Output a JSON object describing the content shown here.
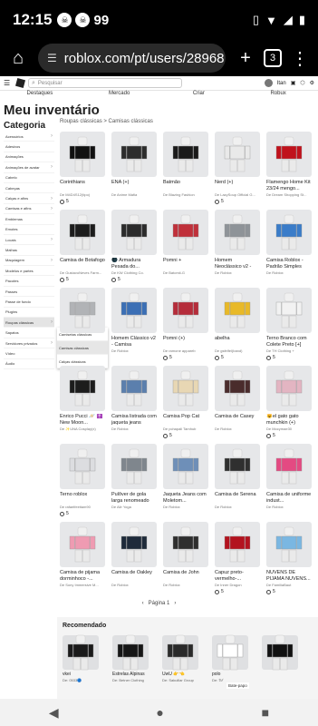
{
  "status": {
    "time": "12:15",
    "signal_num": "99"
  },
  "browser": {
    "url": "roblox.com/pt/users/28968",
    "tabs": "3"
  },
  "nav": {
    "search_placeholder": "Pesquisar",
    "user": "Itan",
    "robux": "0",
    "categories": [
      "Destaques",
      "Mercado",
      "Criar",
      "Robux"
    ]
  },
  "page": {
    "title": "Meu inventário",
    "category_heading": "Categoria",
    "breadcrumb": "Roupas clássicas > Camisas clássicas"
  },
  "sidebar": [
    {
      "label": "Acessórios",
      "arrow": true
    },
    {
      "label": "Adesivos",
      "arrow": false
    },
    {
      "label": "Animações",
      "arrow": false
    },
    {
      "label": "Animações de avatar",
      "arrow": true
    },
    {
      "label": "Cabelo",
      "arrow": false
    },
    {
      "label": "Cabeças",
      "arrow": false
    },
    {
      "label": "Calças e afins",
      "arrow": true
    },
    {
      "label": "Camisas e afins",
      "arrow": true
    },
    {
      "label": "Emblemas",
      "arrow": false
    },
    {
      "label": "Emotes",
      "arrow": false
    },
    {
      "label": "Locais",
      "arrow": true
    },
    {
      "label": "Malhas",
      "arrow": false
    },
    {
      "label": "Maquiagem",
      "arrow": true
    },
    {
      "label": "Modelos e partes",
      "arrow": false
    },
    {
      "label": "Pacotes",
      "arrow": false
    },
    {
      "label": "Passes",
      "arrow": false
    },
    {
      "label": "Passe de fundo",
      "arrow": false
    },
    {
      "label": "Plugins",
      "arrow": false
    },
    {
      "label": "Roupas clássicas",
      "arrow": true,
      "active": true
    },
    {
      "label": "Sapatos",
      "arrow": false
    },
    {
      "label": "Servidores privados",
      "arrow": true
    },
    {
      "label": "Vídeo",
      "arrow": false
    },
    {
      "label": "Áudio",
      "arrow": false
    }
  ],
  "submenu": [
    {
      "label": "Camisetas clássicas"
    },
    {
      "label": "Camisas clássicas",
      "active": true
    },
    {
      "label": "Calças clássicas"
    }
  ],
  "items": [
    {
      "name": "Corinthians",
      "by": "De M4D4S12(tipo)",
      "price": "5",
      "color": "#111111"
    },
    {
      "name": "ENA (+)",
      "by": "De Anime Mafia",
      "price": "",
      "color": "#2c2c2c"
    },
    {
      "name": "Batmão",
      "by": "De Blazing Fashion",
      "price": "",
      "color": "#1a1a1a"
    },
    {
      "name": "Nerd (+)",
      "by": "De LazySoup Official G...",
      "price": "5",
      "color": "#e9e9e9"
    },
    {
      "name": "Flamengo Home Kit 23/24 mengo...",
      "by": "De Dream Shopping St...",
      "price": "",
      "color": "#c0121c"
    },
    {
      "name": "Camisa de Botafogo",
      "by": "De GustavoNeves Farm...",
      "price": "5",
      "color": "#1c1c1c"
    },
    {
      "name": "🌑 Armadura Pesada do...",
      "by": "De KW Clothing Co.",
      "price": "5",
      "color": "#2b2b2b"
    },
    {
      "name": "Pomni +",
      "by": "De Batomii-G",
      "price": "",
      "color": "#c0303a"
    },
    {
      "name": "Homem Neoclássico v2 - Camisa",
      "by": "De Roblox",
      "price": "",
      "color": "#8e9398"
    },
    {
      "name": "Camisa Roblox - Padrão Simples",
      "by": "De Roblox",
      "price": "",
      "color": "#3a7cc9"
    },
    {
      "name": "",
      "by": "",
      "price": "",
      "color": "#b1b3b6"
    },
    {
      "name": "Homem Clássico v2 - Camisa",
      "by": "De Roblox",
      "price": "",
      "color": "#3b6fb5"
    },
    {
      "name": "Pomni (+)",
      "by": "De ramone appareb",
      "price": "5",
      "color": "#b52c3a"
    },
    {
      "name": "abelha",
      "by": "De gsfelfel(band)",
      "price": "5",
      "color": "#e8b928"
    },
    {
      "name": "Terno Branco com Colete Preto [+]",
      "by": "De TH Clothing +",
      "price": "5",
      "color": "#f2f2f2"
    },
    {
      "name": "Enrico Pucci 🪐 ✝️ New Moon...",
      "by": "De ✨UNA Cosplay(x)",
      "price": "",
      "color": "#1c1c1c"
    },
    {
      "name": "Camisa listrada com jaqueta jeans",
      "by": "De Roblox",
      "price": "",
      "color": "#5b7fad"
    },
    {
      "name": "Camisa Pop Cat",
      "by": "De pchapali Tamhub",
      "price": "5",
      "color": "#e8d7b4"
    },
    {
      "name": "Camisa de Casey",
      "by": "De Roblox",
      "price": "",
      "color": "#4a2c2c"
    },
    {
      "name": "😺el gato gato munchkin (+)",
      "by": "De Mocymae30",
      "price": "5",
      "color": "#e3b5c2"
    },
    {
      "name": "Terno roblox",
      "by": "De rafaelfeeitam90",
      "price": "5",
      "color": "#dcdde0"
    },
    {
      "name": "Pulôver de gola larga renomeado",
      "by": "De Alir Yoga",
      "price": "",
      "color": "#7f868d"
    },
    {
      "name": "Jaqueta Jeans com Moletom...",
      "by": "De Roblox",
      "price": "",
      "color": "#6e8fb8"
    },
    {
      "name": "Camisa de Serena",
      "by": "De Roblox",
      "price": "",
      "color": "#2f2f2f"
    },
    {
      "name": "Camisa de uniforme indust...",
      "by": "De Roblox",
      "price": "",
      "color": "#e44a82"
    },
    {
      "name": "Camisa de pijama dorminhoco -...",
      "by": "De Sony Immersive M...",
      "price": "",
      "color": "#ef9bb2"
    },
    {
      "name": "Camisa de Oakley",
      "by": "De Roblox",
      "price": "",
      "color": "#1e2a3a"
    },
    {
      "name": "Camisa de John",
      "by": "De Roblox",
      "price": "",
      "color": "#2e2e2e"
    },
    {
      "name": "Capuz preto-vermelho-...",
      "by": "De Inner Dragon",
      "price": "5",
      "color": "#b3131f"
    },
    {
      "name": "NUVENS DE PIJAMA NUVENS...",
      "by": "De FamiliaBaut",
      "price": "5",
      "color": "#7ab7e2"
    }
  ],
  "pagination": {
    "prev": "‹",
    "label": "Página 1",
    "next": "›"
  },
  "recommended": {
    "title": "Recomendado",
    "items": [
      {
        "name": "vkei",
        "by": "De: 0533🔵",
        "color": "#1a1a1a"
      },
      {
        "name": "Estrelas Alpinas",
        "by": "De: Betner Clothing",
        "color": "#161616"
      },
      {
        "name": "UwU 👉👈",
        "by": "De: Sakuillar Group",
        "color": "#2a2a2a"
      },
      {
        "name": "polo",
        "by": "De: ℬ𝓁",
        "color": "#ffffff"
      },
      {
        "name": "",
        "by": "",
        "color": "#111111"
      }
    ]
  },
  "chat_label": "Bate-papo",
  "android_nav": {
    "back": "◀",
    "home": "●",
    "recents": "■"
  }
}
